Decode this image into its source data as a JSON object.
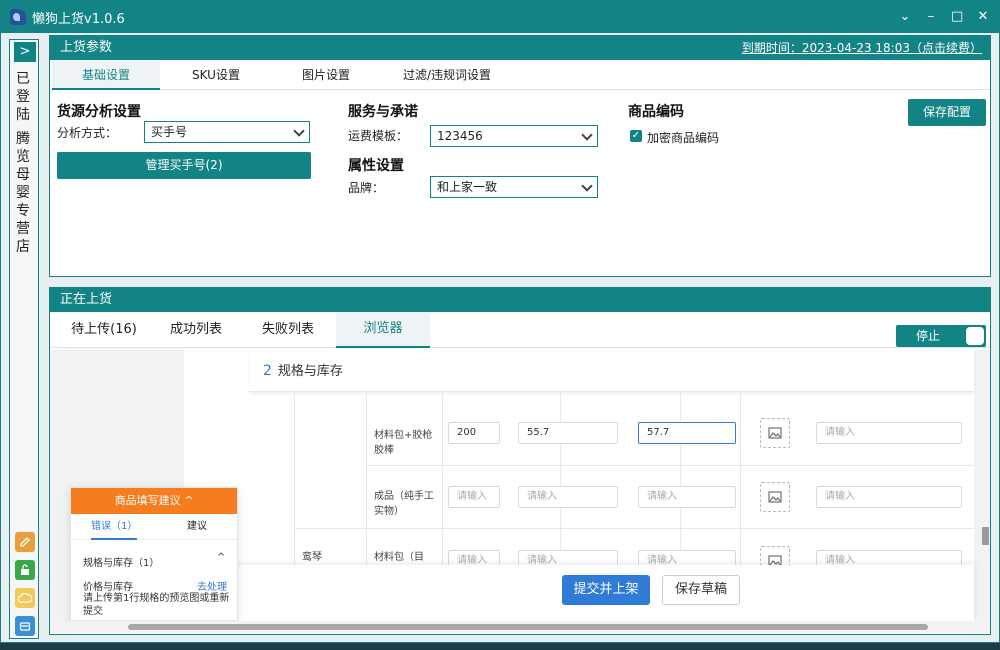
{
  "app": {
    "title": "懒狗上货v1.0.6",
    "controls": {
      "minimize": "⌄",
      "restore": "–",
      "maximize": "□",
      "close": "✕"
    }
  },
  "sidebar": {
    "expand_label": ">",
    "login_status": "已登陆",
    "shop_name": "腾览母婴专营店",
    "button_colors": [
      "#e8a03a",
      "#3aa84a",
      "#f3c95a",
      "#3b8fd6"
    ]
  },
  "params_panel": {
    "title": "上货参数",
    "expiry": "到期时间：2023-04-23 18:03（点击续费）",
    "tabs": [
      "基础设置",
      "SKU设置",
      "图片设置",
      "过滤/违规词设置"
    ],
    "active_tab": 0,
    "source": {
      "title": "货源分析设置",
      "method_label": "分析方式：",
      "method_value": "买手号",
      "manage_button": "管理买手号(2)"
    },
    "service": {
      "title": "服务与承诺",
      "freight_label": "运费模板：",
      "freight_value": "123456"
    },
    "attributes": {
      "title": "属性设置",
      "brand_label": "品牌：",
      "brand_value": "和上家一致"
    },
    "product_code": {
      "title": "商品编码",
      "encrypt_label": "加密商品编码",
      "encrypt_checked": true
    },
    "save_button": "保存配置"
  },
  "upload_panel": {
    "title": "正在上货",
    "tabs": [
      "待上传(16)",
      "成功列表",
      "失败列表",
      "浏览器"
    ],
    "active_tab": 3,
    "stop_label": "停止",
    "browser": {
      "section_num": "2",
      "section_title": "规格与库存",
      "rows": [
        {
          "group": "",
          "name": "材料包+胶枪胶棒",
          "qty": "200",
          "price": "55.7",
          "price2": "57.7",
          "code": "请输入"
        },
        {
          "group": "",
          "name": "成品（纯手工实物）",
          "qty": "请输入",
          "price": "请输入",
          "price2": "请输入",
          "code": "请输入"
        },
        {
          "group": "鸾琴",
          "name": "材料包（目",
          "qty": "请输入",
          "price": "请输入",
          "price2": "请输入",
          "code": "请输入"
        }
      ],
      "submit_button": "提交并上架",
      "draft_button": "保存草稿",
      "suggestion": {
        "header": "商品填写建议 ^",
        "tab_errors": "错误（1）",
        "tab_suggest": "建议",
        "group_title": "规格与库存（1）",
        "item_title": "价格与库存",
        "item_action": "去处理",
        "item_desc": "请上传第1行规格的预览图或重新提交"
      }
    }
  }
}
